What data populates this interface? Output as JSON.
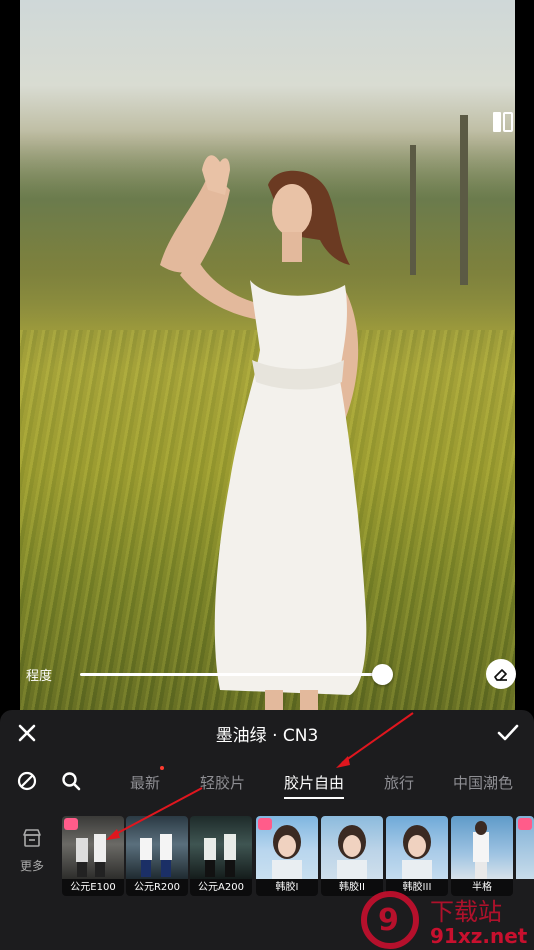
{
  "editor": {
    "intensity_label": "程度",
    "intensity_value": 1.0
  },
  "panel": {
    "filter_title": "墨油绿 · CN3",
    "categories": [
      "最新",
      "轻胶片",
      "胶片自由",
      "旅行",
      "中国潮色"
    ],
    "active_category": "胶片自由",
    "more_label": "更多",
    "thumbnails": [
      {
        "label": "公元E100"
      },
      {
        "label": "公元R200"
      },
      {
        "label": "公元A200"
      },
      {
        "label": "韩胶I"
      },
      {
        "label": "韩胶II"
      },
      {
        "label": "韩胶III"
      },
      {
        "label": "半格"
      }
    ]
  },
  "colors": {
    "panel_bg": "#1c1c1e",
    "active_text": "#ffffff",
    "inactive_text": "#8e8e93",
    "annotation_red": "#e0161e",
    "badge_pink": "#ff5c8a"
  },
  "icons": {
    "close": "close-icon",
    "confirm": "check-icon",
    "none": "no-filter-icon",
    "search": "search-icon",
    "more": "store-icon",
    "eraser": "eraser-icon",
    "compare": "split-compare-icon"
  },
  "watermark": {
    "text": "91xz.net",
    "logo_text": "下载站"
  }
}
